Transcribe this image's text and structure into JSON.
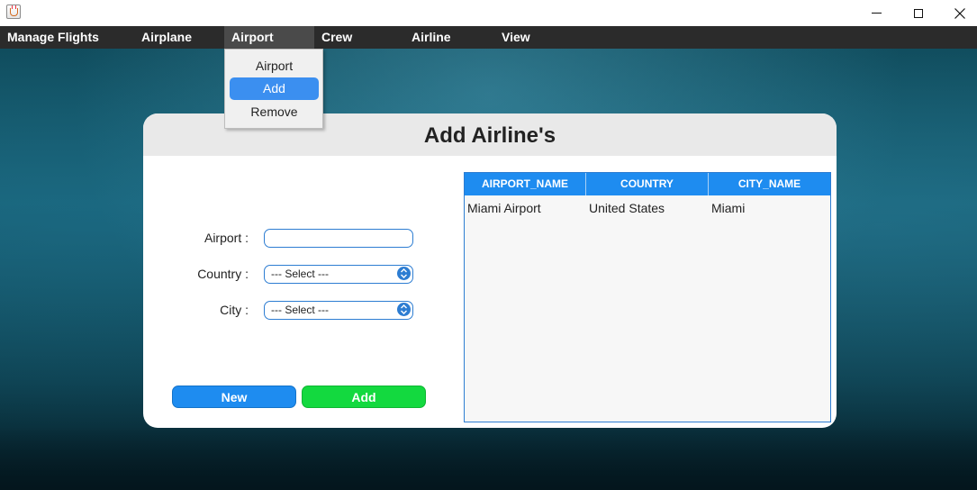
{
  "window": {
    "minimize_icon": "minimize-icon",
    "maximize_icon": "maximize-icon",
    "close_icon": "close-icon"
  },
  "menubar": {
    "items": [
      "Manage Flights",
      "Airplane",
      "Airport",
      "Crew",
      "Airline",
      "View"
    ],
    "active": "Airport"
  },
  "dropdown": {
    "items": [
      "Airport",
      "Add",
      "Remove"
    ],
    "selected": "Add"
  },
  "form": {
    "title": "Add Airline's",
    "airport_label": "Airport :",
    "airport_value": "",
    "country_label": "Country :",
    "country_value": "--- Select ---",
    "city_label": "City :",
    "city_value": "--- Select ---",
    "new_button": "New",
    "add_button": "Add"
  },
  "table": {
    "columns": [
      "AIRPORT_NAME",
      "COUNTRY",
      "CITY_NAME"
    ],
    "rows": [
      [
        "Miami Airport",
        "United States",
        "Miami"
      ]
    ]
  },
  "colors": {
    "accent": "#1e8cf0",
    "add_green": "#13d93f",
    "menubar": "#2b2b2b"
  }
}
